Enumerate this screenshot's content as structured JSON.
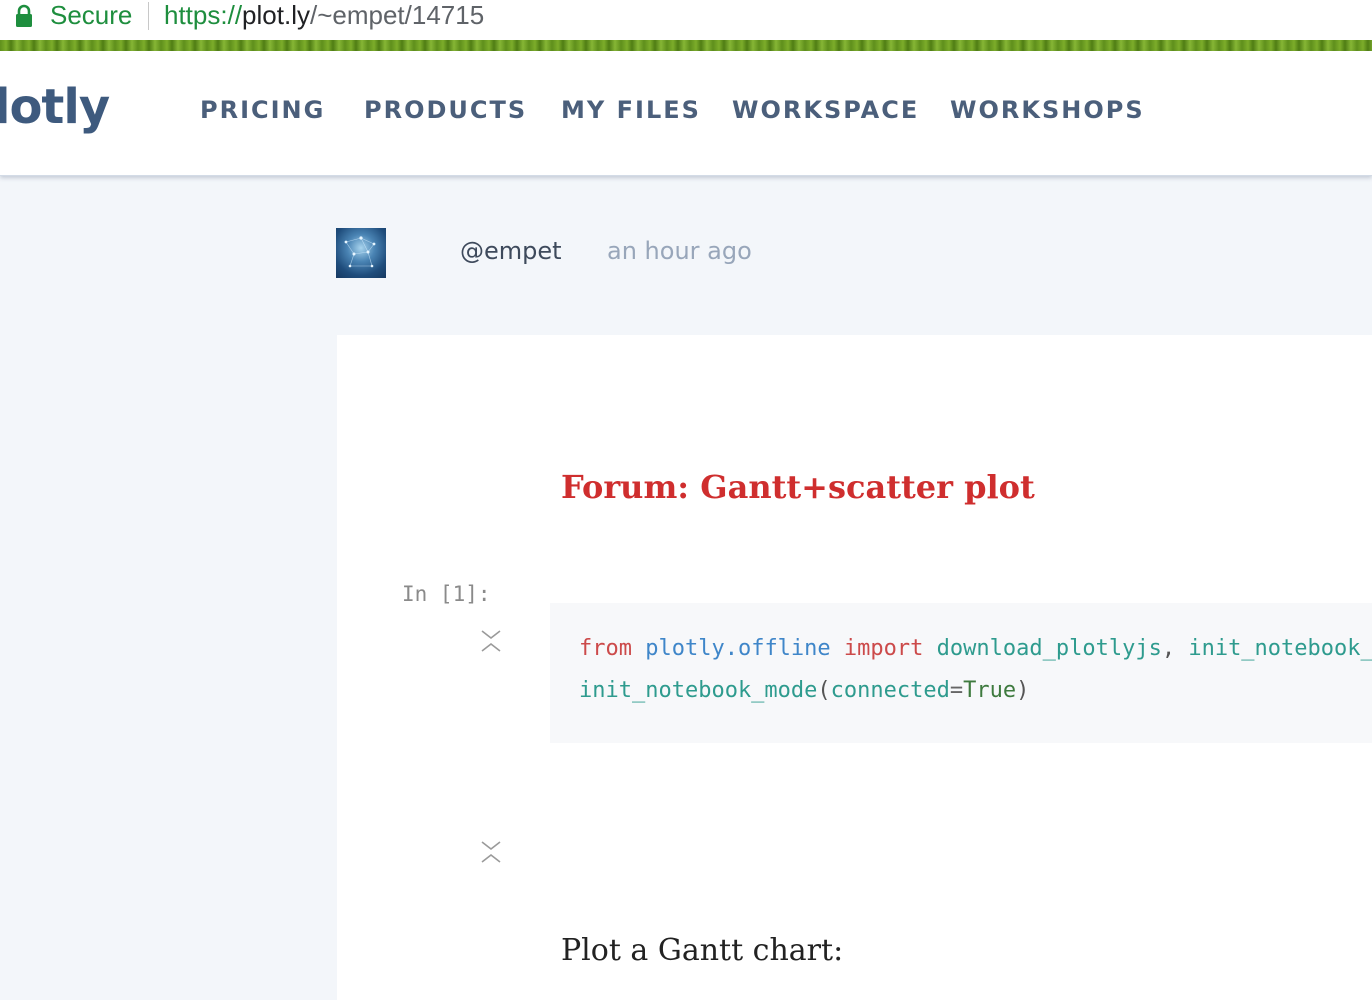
{
  "browser": {
    "secure_label": "Secure",
    "url_scheme": "https://",
    "url_host": "plot.ly",
    "url_path": "/~empet/14715"
  },
  "navbar": {
    "logo": "lotly",
    "items": [
      {
        "label": "PRICING"
      },
      {
        "label": "PRODUCTS"
      },
      {
        "label": "MY FILES"
      },
      {
        "label": "WORKSPACE"
      },
      {
        "label": "WORKSHOPS"
      }
    ]
  },
  "author": {
    "username": "@empet",
    "timestamp": "an hour ago"
  },
  "notebook": {
    "title": "Forum: Gantt+scatter plot",
    "prompt": "In [1]:",
    "code": {
      "line1": {
        "kw_from": "from",
        "module": "plotly.offline",
        "kw_import": "import",
        "name1": "download_plotlyjs",
        "comma": ",",
        "name2": "init_notebook_mode"
      },
      "line2": {
        "func": "init_notebook_mode",
        "lparen": "(",
        "arg": "connected",
        "eq": "=",
        "value": "True",
        "rparen": ")"
      }
    },
    "subheading": "Plot a Gantt chart:"
  },
  "colors": {
    "secure_green": "#1e8e3e",
    "nav_text": "#4b5f7b",
    "title_red": "#cf2e2e",
    "page_bg": "#f3f6fa"
  }
}
